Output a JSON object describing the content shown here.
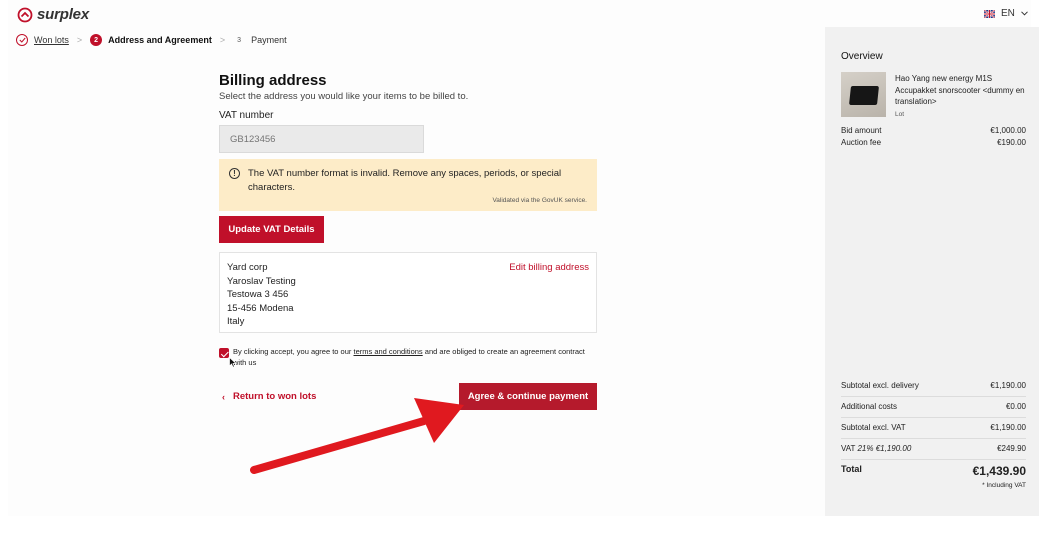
{
  "header": {
    "logo_text": "surplex",
    "language": "EN"
  },
  "steps": [
    {
      "number": "",
      "label": "Won lots",
      "state": "done"
    },
    {
      "number": "2",
      "label": "Address and Agreement",
      "state": "active"
    },
    {
      "number": "3",
      "label": "Payment",
      "state": "todo"
    }
  ],
  "billing": {
    "title": "Billing address",
    "subtitle": "Select the address you would like your items to be billed to.",
    "vat_label": "VAT number",
    "vat_placeholder": "GB123456",
    "alert_message": "The VAT number format is invalid. Remove any spaces, periods, or special characters.",
    "alert_note": "Validated via the GovUK service.",
    "update_button": "Update VAT Details",
    "edit_link": "Edit billing address",
    "address_lines": [
      "Yard corp",
      "Yaroslav Testing",
      "Testowa 3 456",
      "15-456 Modena",
      "Italy"
    ]
  },
  "agreement": {
    "text_before": "By clicking accept, you agree to our ",
    "link_text": "terms and conditions",
    "text_after": " and are obliged to create an agreement contract with us",
    "checked": true
  },
  "actions": {
    "back_label": "Return to won lots",
    "agree_label": "Agree & continue payment"
  },
  "overview": {
    "title": "Overview",
    "product_name": "Hao Yang new energy M1S Accupakket snorscooter <dummy en translation>",
    "product_type": "Lot",
    "bid_label": "Bid amount",
    "bid_value": "€1,000.00",
    "fee_label": "Auction fee",
    "fee_value": "€190.00",
    "subtotal_delivery_label": "Subtotal excl. delivery",
    "subtotal_delivery_value": "€1,190.00",
    "additional_label": "Additional costs",
    "additional_value": "€0.00",
    "subtotal_vat_label": "Subtotal excl. VAT",
    "subtotal_vat_value": "€1,190.00",
    "vat_label": "VAT",
    "vat_detail": "21% €1,190.00",
    "vat_value": "€249.90",
    "total_label": "Total",
    "total_value": "€1,439.90",
    "including_vat": "* Including VAT"
  },
  "colors": {
    "brand_red": "#c0102a",
    "alert_background": "#fdecc8",
    "annotation_arrow": "#e0191f"
  }
}
